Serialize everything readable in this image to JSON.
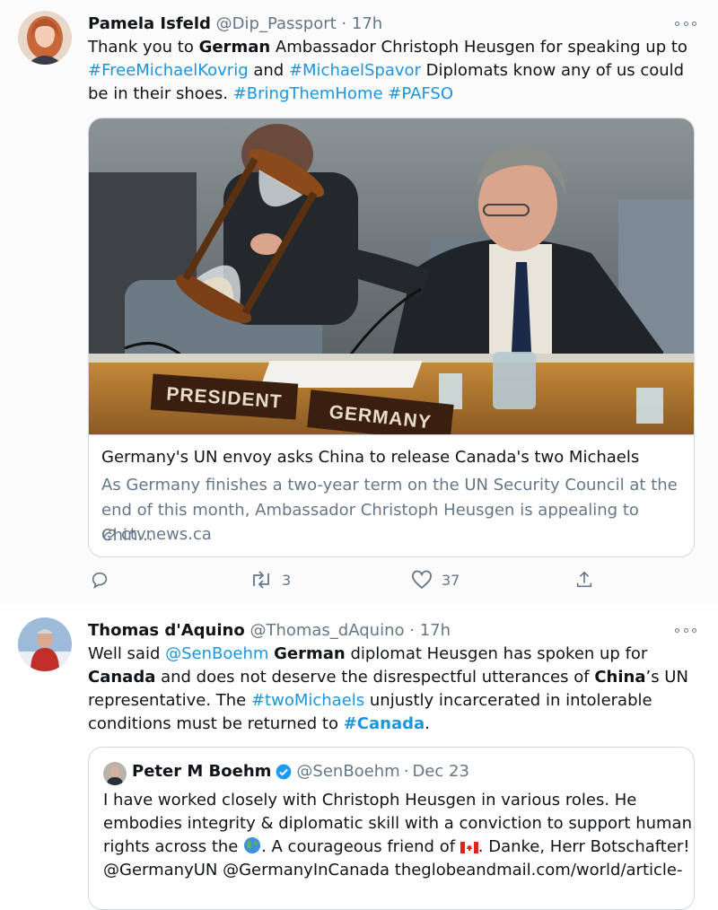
{
  "tweet1": {
    "name": "Pamela Isfeld",
    "handle": "@Dip_Passport",
    "dot": "·",
    "time": "17h",
    "text_1": "Thank you to ",
    "text_bold_1": "German",
    "text_2": " Ambassador Christoph Heusgen for speaking up  to ",
    "hashtag_1": "#FreeMichaelKovrig",
    "text_3": " and ",
    "hashtag_2": "#MichaelSpavor",
    "text_4": " Diplomats know any of us could be in their shoes. ",
    "hashtag_3": "#BringThemHome",
    "text_5": " ",
    "hashtag_4": "#PAFSO",
    "card": {
      "sign_1": "PRESIDENT",
      "sign_2": "GERMANY",
      "title": "Germany's UN envoy asks China to release Canada's two Michaels",
      "description": "As Germany finishes a two-year term on the UN Security Council at the end of this month, Ambassador Christoph Heusgen is appealing to Chin...",
      "domain": "ctvnews.ca"
    },
    "actions": {
      "retweets": "3",
      "likes": "37"
    }
  },
  "tweet2": {
    "name": "Thomas d'Aquino",
    "handle": "@Thomas_dAquino",
    "dot": "·",
    "time": "17h",
    "text_1": "Well said ",
    "mention_1": "@SenBoehm",
    "text_2": " ",
    "bold_1": "German",
    "text_3": " diplomat Heusgen has spoken up for ",
    "bold_2": "Canada",
    "text_4": " and does not deserve the disrespectful utterances of ",
    "bold_3": "China",
    "text_5": "’s UN representative. The ",
    "hashtag_1": "#twoMichaels",
    "text_6": " unjustly incarcerated in intolerable conditions must be returned to ",
    "hashtag_2": "#Canada",
    "text_7": ".",
    "quote": {
      "name": "Peter M Boehm",
      "handle": "@SenBoehm",
      "dot": "·",
      "time": "Dec 23",
      "line_1": "I have worked closely with Christoph Heusgen in various roles. He",
      "line_2": "embodies integrity & diplomatic skill with a conviction to support human",
      "line_3a": "rights across the ",
      "line_3b": ". A courageous friend of ",
      "line_3c": ". Danke, Herr Botschafter!",
      "line_4": "@GermanyUN @GermanyInCanada  theglobeandmail.com/world/article-"
    }
  },
  "colors": {
    "link": "#1b95e0",
    "text": "#0f1419",
    "secondary": "#657786",
    "border": "#cfd9de",
    "verified": "#1d9bf0"
  },
  "icons": {
    "reply": "speech-bubble-icon",
    "retweet": "retweet-icon",
    "like": "heart-icon",
    "share": "share-icon",
    "more": "more-dots-icon",
    "link": "link-icon",
    "verified": "verified-badge-icon"
  }
}
